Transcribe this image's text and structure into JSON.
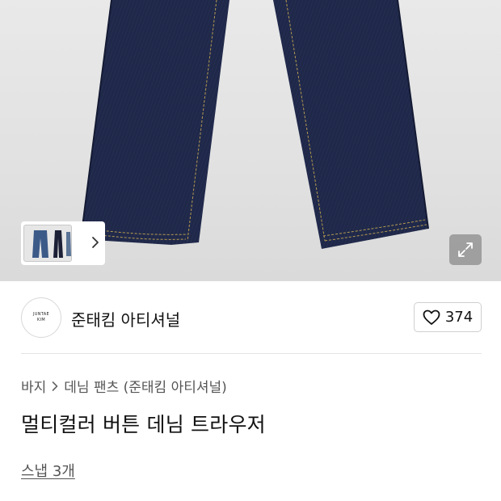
{
  "product_image": {
    "alt": "",
    "colors": {
      "denim": "#1d2547",
      "stitch": "#b59a52",
      "background": "#e4e4e4"
    }
  },
  "gallery": {
    "next_icon": "chevron-right-icon",
    "expand_icon": "expand-icon"
  },
  "brand": {
    "logo_line1": "JUNTAE",
    "logo_line2": "KIM",
    "name": "준태킴 아티셔널"
  },
  "like": {
    "icon": "heart-icon",
    "count": "374"
  },
  "breadcrumb": {
    "category": "바지",
    "subcategory": "데님 팬츠 (준태킴 아티셔널)"
  },
  "product": {
    "title": "멀티컬러 버튼 데님 트라우저"
  },
  "snap": {
    "label": "스냅 3개"
  }
}
